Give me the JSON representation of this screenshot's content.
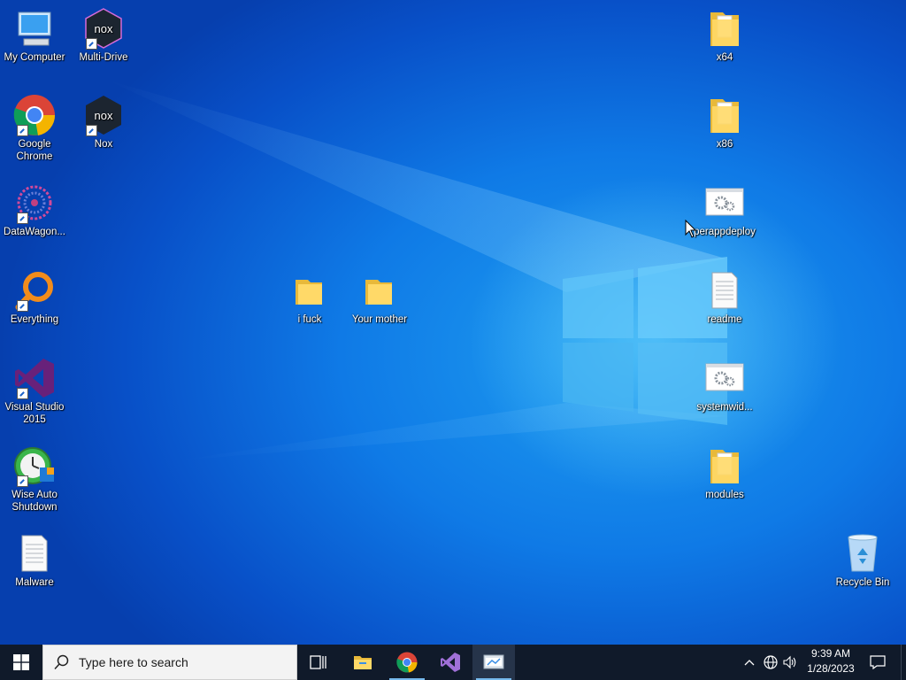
{
  "desktop_icons": {
    "my_computer": "My Computer",
    "multi_drive": "Multi-Drive",
    "google_chrome": "Google Chrome",
    "nox": "Nox",
    "datawagon": "DataWagon...",
    "everything": "Everything",
    "visual_studio": "Visual Studio 2015",
    "wise_auto_shutdown": "Wise Auto Shutdown",
    "malware": "Malware",
    "folder_ifuck": "i fuck",
    "folder_your_mother": "Your mother",
    "x64": "x64",
    "x86": "x86",
    "perappdeploy": "perappdeploy",
    "readme": "readme",
    "systemwid": "systemwid...",
    "modules": "modules",
    "recycle_bin": "Recycle Bin"
  },
  "taskbar": {
    "search_placeholder": "Type here to search",
    "pinned": [
      "task-view",
      "file-explorer",
      "google-chrome",
      "visual-studio",
      "control-panel"
    ]
  },
  "clock": {
    "time": "9:39 AM",
    "date": "1/28/2023"
  },
  "colors": {
    "desktop_blue": "#0a5bd6",
    "taskbar": "#101a2a",
    "active_indicator": "#76b9ed"
  }
}
